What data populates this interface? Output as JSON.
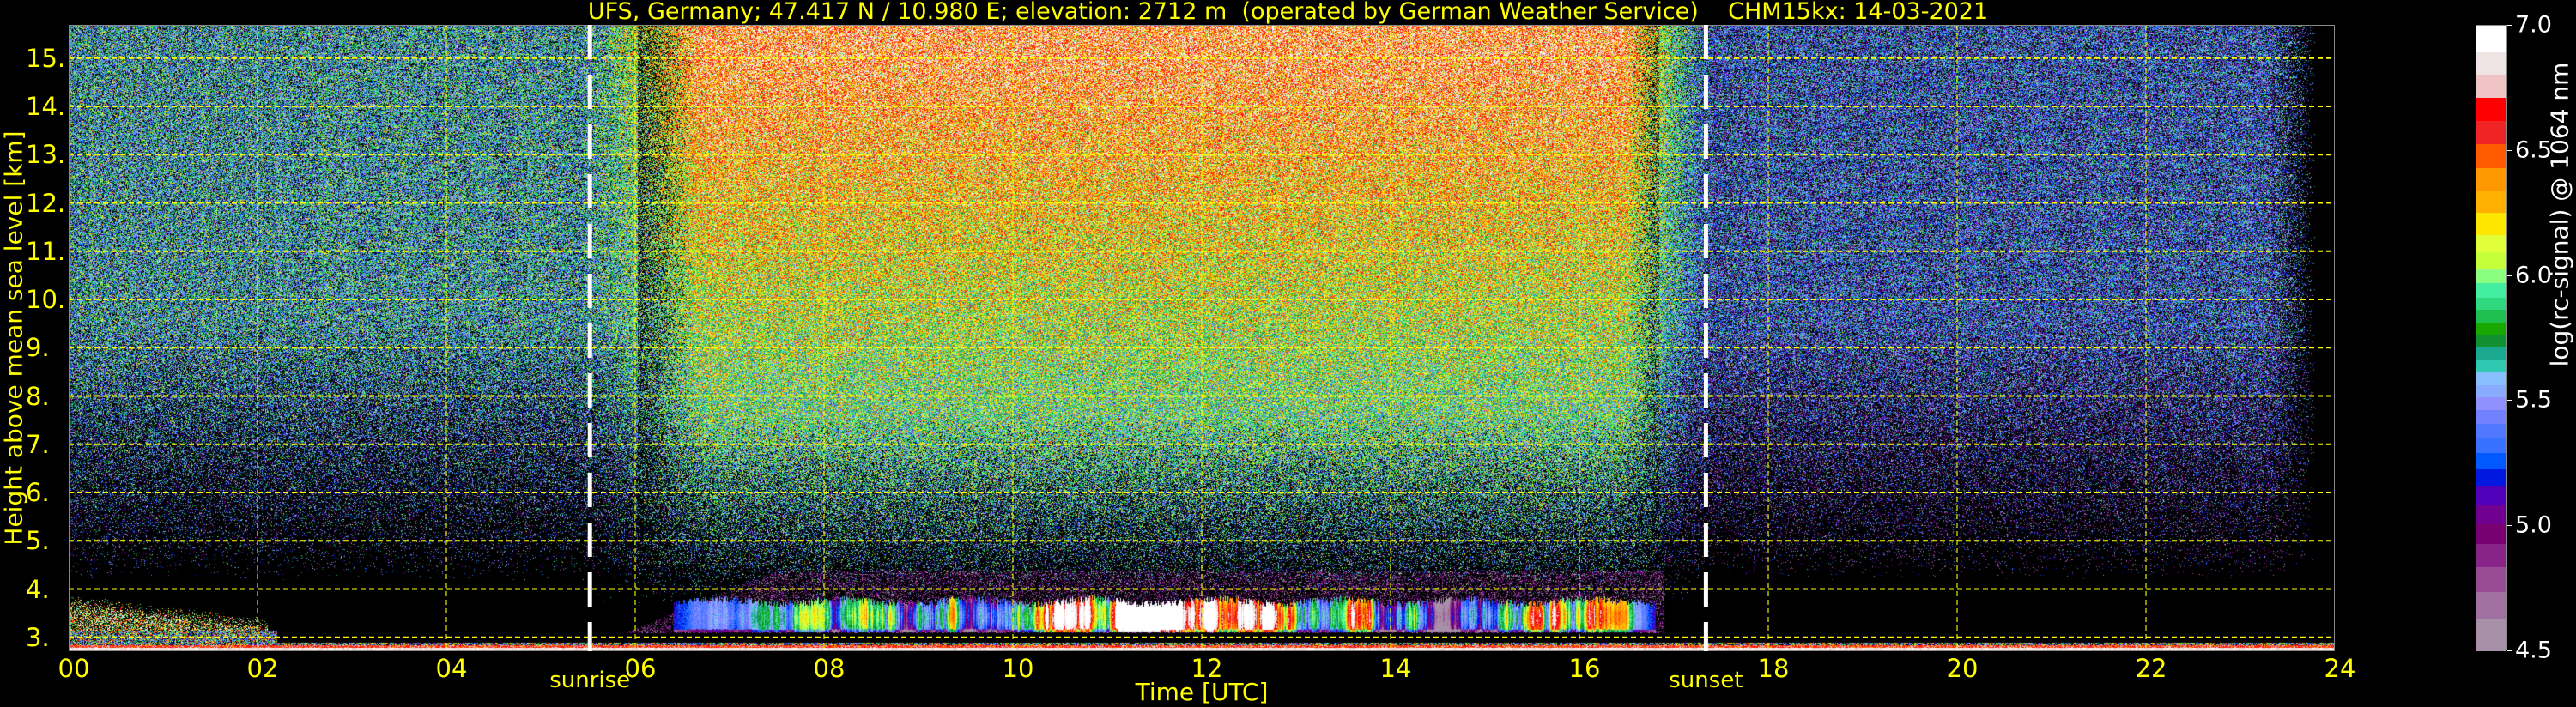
{
  "chart_data": {
    "type": "heatmap",
    "title": "UFS, Germany; 47.417 N / 10.980 E; elevation: 2712 m  (operated by German Weather Service)    CHM15kx: 14-03-2021",
    "xlabel": "Time [UTC]",
    "ylabel": "Height above mean sea level [km]",
    "xlim": [
      0,
      24
    ],
    "ylim": [
      2.712,
      15.69
    ],
    "x_ticks": [
      0,
      2,
      4,
      6,
      8,
      10,
      12,
      14,
      16,
      18,
      20,
      22,
      24
    ],
    "x_tick_labels": [
      "00",
      "02",
      "04",
      "06",
      "08",
      "10",
      "12",
      "14",
      "16",
      "18",
      "20",
      "22",
      "24"
    ],
    "y_ticks": [
      3,
      4,
      5,
      6,
      7,
      8,
      9,
      10,
      11,
      12,
      13,
      14,
      15
    ],
    "y_tick_labels": [
      "3.",
      "4.",
      "5.",
      "6.",
      "7.",
      "8.",
      "9.",
      "10.",
      "11.",
      "12.",
      "13.",
      "14.",
      "15."
    ],
    "grid": true,
    "grid_color": "#ffff00",
    "markers": [
      {
        "label": "sunrise",
        "time_h": 5.52,
        "color": "#ffffff",
        "style": "dashed"
      },
      {
        "label": "sunset",
        "time_h": 17.34,
        "color": "#ffffff",
        "style": "dashed"
      }
    ],
    "colorbar": {
      "label": "log(rc-signal) @ 1064 nm",
      "range": [
        4.5,
        7.0
      ],
      "ticks": [
        4.5,
        5.0,
        5.5,
        6.0,
        6.5,
        7.0
      ],
      "tick_labels": [
        "4.5",
        "5.0",
        "5.5",
        "6.0",
        "6.5",
        "7.0"
      ],
      "levels": [
        4.5,
        4.628,
        4.74,
        4.837,
        4.929,
        5.01,
        5.089,
        5.159,
        5.228,
        5.293,
        5.354,
        5.41,
        5.466,
        5.516,
        5.566,
        5.619,
        5.669,
        5.718,
        5.766,
        5.815,
        5.865,
        5.916,
        5.972,
        6.029,
        6.096,
        6.166,
        6.253,
        6.339,
        6.431,
        6.53,
        6.62,
        6.712,
        6.805,
        6.897,
        7.0
      ],
      "colors": [
        "#a890a8",
        "#a070a0",
        "#984c94",
        "#882488",
        "#780070",
        "#700090",
        "#5000b8",
        "#0018e0",
        "#0058ff",
        "#3870ff",
        "#5078ff",
        "#7080ff",
        "#9090ff",
        "#88aaff",
        "#88c0ff",
        "#30c8b0",
        "#1aa890",
        "#109030",
        "#18a800",
        "#20c050",
        "#30d880",
        "#44eea0",
        "#8aff80",
        "#c4ff3a",
        "#e0ff3a",
        "#ffe600",
        "#ffb000",
        "#ff9800",
        "#ff5a00",
        "#f02424",
        "#ff0000",
        "#f0c4c4",
        "#eee4e4",
        "#ffffff"
      ]
    }
  }
}
